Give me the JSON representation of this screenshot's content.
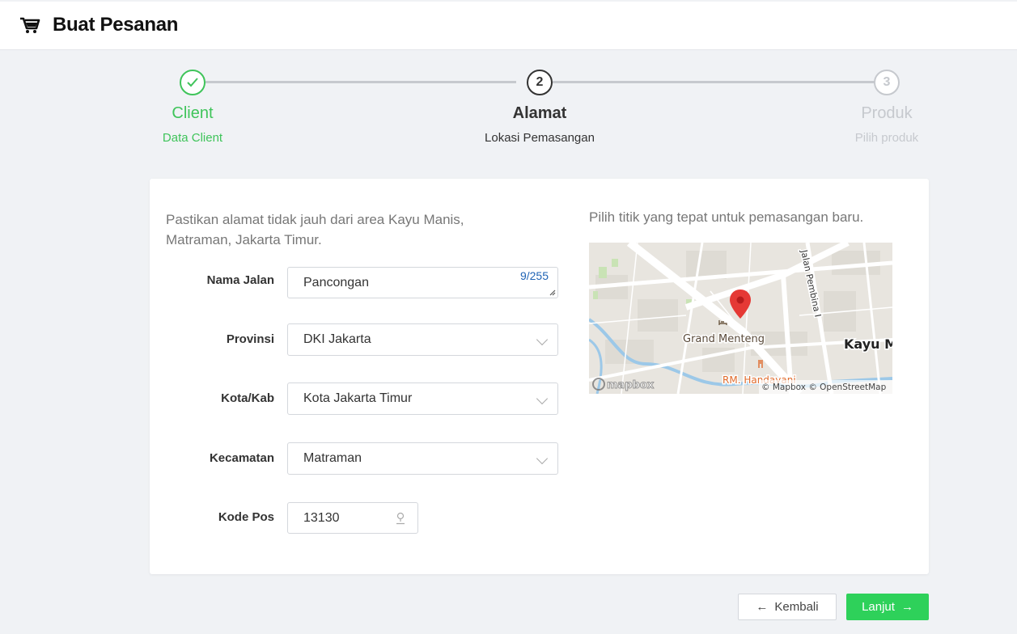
{
  "header": {
    "title": "Buat Pesanan",
    "icon": "shopping-cart-icon"
  },
  "stepper": {
    "steps": [
      {
        "number": "",
        "title": "Client",
        "subtitle": "Data Client",
        "state": "done"
      },
      {
        "number": "2",
        "title": "Alamat",
        "subtitle": "Lokasi Pemasangan",
        "state": "active"
      },
      {
        "number": "3",
        "title": "Produk",
        "subtitle": "Pilih produk",
        "state": "pending"
      }
    ],
    "colors": {
      "done": "#3fc45a",
      "active": "#333333",
      "pending": "#c6c9ce"
    }
  },
  "form": {
    "notice": "Pastikan alamat tidak jauh dari area Kayu Manis, Matraman, Jakarta Timur.",
    "fields": {
      "street": {
        "label": "Nama Jalan",
        "value": "Pancongan",
        "counter": "9/255"
      },
      "province": {
        "label": "Provinsi",
        "value": "DKI Jakarta"
      },
      "city": {
        "label": "Kota/Kab",
        "value": "Kota Jakarta Timur"
      },
      "district": {
        "label": "Kecamatan",
        "value": "Matraman"
      },
      "postal": {
        "label": "Kode Pos",
        "value": "13130"
      }
    }
  },
  "map": {
    "hint": "Pilih titik yang tepat untuk pemasangan baru.",
    "labels": {
      "street": "Jalan Pembina I",
      "place": "Grand Menteng",
      "area": "Kayu M",
      "restaurant": "RM. Handayani",
      "logo": "mapbox",
      "attribution": "© Mapbox © OpenStreetMap"
    }
  },
  "actions": {
    "back": "Kembali",
    "next": "Lanjut"
  },
  "colors": {
    "accent": "#2ed15a",
    "link": "#1f63b5",
    "pin": "#e53935"
  }
}
